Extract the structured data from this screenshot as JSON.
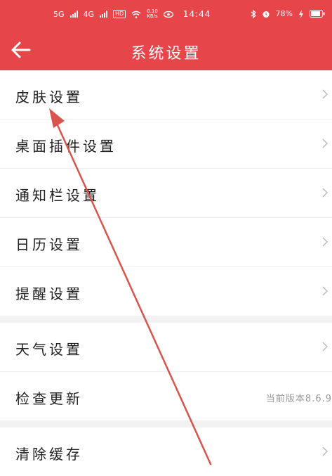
{
  "status_bar": {
    "net1": "5G",
    "net2": "4G",
    "hd": "HD",
    "speed_top": "0.10",
    "speed_bottom": "KB/s",
    "time": "14:44",
    "battery": "78%"
  },
  "header": {
    "title": "系统设置"
  },
  "groups": [
    {
      "items": [
        {
          "label": "皮肤设置"
        },
        {
          "label": "桌面插件设置"
        },
        {
          "label": "通知栏设置"
        },
        {
          "label": "日历设置"
        },
        {
          "label": "提醒设置"
        }
      ]
    },
    {
      "items": [
        {
          "label": "天气设置"
        },
        {
          "label": "检查更新",
          "value": "当前版本8.6.9"
        }
      ]
    },
    {
      "items": [
        {
          "label": "清除缓存"
        }
      ]
    }
  ],
  "colors": {
    "accent": "#e6464a",
    "annotation_arrow": "#d9544d"
  }
}
